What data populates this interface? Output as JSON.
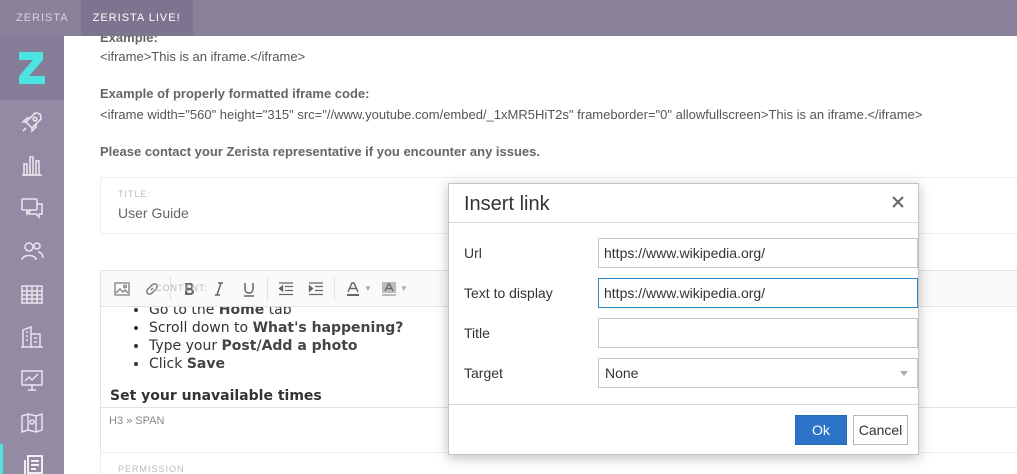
{
  "topbar": {
    "tabs": [
      "ZERISTA",
      "ZERISTA LIVE!"
    ]
  },
  "sidebar": {
    "icons": [
      "rocket-icon",
      "bar-chart-icon",
      "chat-icon",
      "people-icon",
      "calendar-grid-icon",
      "building-icon",
      "presentation-icon",
      "map-icon",
      "documents-icon"
    ]
  },
  "content": {
    "example_label": "Example:",
    "example_code": "<iframe>This is an iframe.</iframe>",
    "formatted_label": "Example of properly formatted iframe code:",
    "formatted_code": "<iframe width=\"560\" height=\"315\" src=\"//www.youtube.com/embed/_1xMR5HiT2s\" frameborder=\"0\" allowfullscreen>This is an iframe.</iframe>",
    "contact_note": "Please contact your Zerista representative if you encounter any issues.",
    "title_label": "TITLE:",
    "title_value": "User Guide",
    "content_label": "CONTENT:",
    "permission_label": "PERMISSION"
  },
  "editor": {
    "list": [
      {
        "pre": "Go to the ",
        "bold": "Home",
        "post": " tab"
      },
      {
        "pre": "Scroll down to ",
        "bold": "What's happening?",
        "post": ""
      },
      {
        "pre": "Type your ",
        "bold": "Post/Add a photo",
        "post": ""
      },
      {
        "pre": "Click ",
        "bold": "Save",
        "post": ""
      }
    ],
    "heading": "Set your unavailable times",
    "status": "H3 » SPAN"
  },
  "dialog": {
    "title": "Insert link",
    "url_label": "Url",
    "url_value": "https://www.wikipedia.org/",
    "text_label": "Text to display",
    "text_value": "https://www.wikipedia.org/",
    "title_label": "Title",
    "title_value": "",
    "target_label": "Target",
    "target_value": "None",
    "ok_label": "Ok",
    "cancel_label": "Cancel"
  },
  "colors": {
    "accent": "#4de3e0",
    "sidebar": "#938aa3",
    "topbar": "#8a819b",
    "ok_button": "#2d73c8"
  }
}
